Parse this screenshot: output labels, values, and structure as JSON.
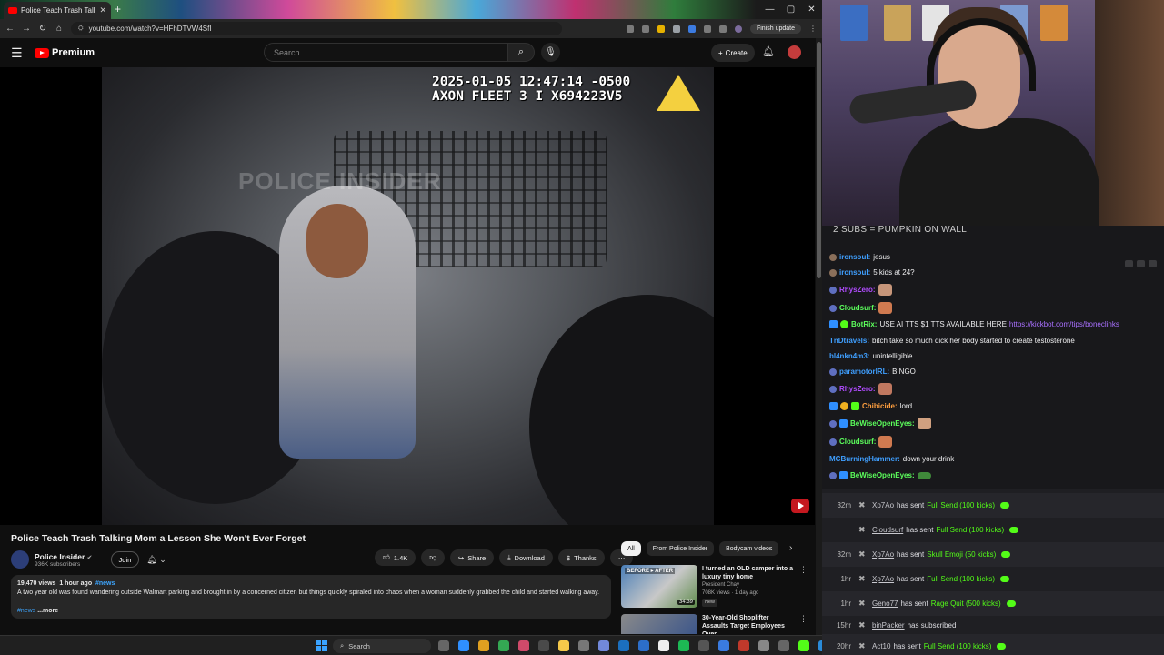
{
  "browser": {
    "tab_title": "Police Teach Trash Talking M",
    "tab_close": "✕",
    "new_tab": "+",
    "url": "youtube.com/watch?v=HFhDTVW4SfI",
    "finish_update": "Finish update",
    "win_minimize": "—",
    "win_maximize": "▢",
    "win_close": "✕"
  },
  "youtube": {
    "logo_text": "Premium",
    "search_placeholder": "Search",
    "create_label": "Create",
    "video_overlay_line1": "2025-01-05 12:47:14 -0500",
    "video_overlay_line2": "AXON FLEET 3 I X694223V5",
    "watermark": "POLICE INSIDER",
    "title": "Police Teach Trash Talking Mom a Lesson She Won't Ever Forget",
    "channel_name": "Police Insider",
    "channel_subs": "936K subscribers",
    "join_label": "Join",
    "likes": "1.4K",
    "share_label": "Share",
    "download_label": "Download",
    "thanks_label": "Thanks",
    "views": "19,470 views",
    "age": "1 hour ago",
    "desc_tag": "#news",
    "description": "A two year old was found wandering outside Walmart parking and brought in by a concerned citizen but things quickly spiraled into chaos when a woman suddenly grabbed the child and started walking away.",
    "desc_tag_bottom": "#news",
    "more_label": "...more",
    "chips": [
      "All",
      "From Police Insider",
      "Bodycam videos"
    ],
    "recommended": [
      {
        "title": "I turned an OLD camper into a luxury tiny home",
        "channel": "President Chay",
        "meta": "708K views · 1 day ago",
        "badge": "New",
        "duration": "34:39",
        "thumb_text": "BEFORE ▸ AFTER"
      },
      {
        "title": "30-Year-Old Shoplifter Assaults Target Employees Over ...",
        "channel": "",
        "meta": "",
        "badge": "",
        "duration": "",
        "thumb_text": ""
      }
    ]
  },
  "chat": {
    "goal": "2 SUBS = PUMPKIN ON WALL",
    "messages": [
      {
        "user": "ironsoul",
        "color": "#3f9fff",
        "text": "jesus"
      },
      {
        "user": "ironsoul",
        "color": "#3f9fff",
        "text": "5 kids at 24?"
      },
      {
        "user": "RhysZero",
        "color": "#b14cff",
        "text": ""
      },
      {
        "user": "Cloudsurf",
        "color": "#5cff5c",
        "text": ""
      },
      {
        "user": "BotRix",
        "color": "#5cff5c",
        "text": "USE AI TTS $1 TTS AVAILABLE HERE",
        "link": "https://kickbot.com/tips/boneclinks"
      },
      {
        "user": "TnDtravels",
        "color": "#3f9fff",
        "text": "bitch take so much dick her body started to create testosterone"
      },
      {
        "user": "bl4nkn4m3",
        "color": "#3f9fff",
        "text": "unintelligible"
      },
      {
        "user": "paramotorIRL",
        "color": "#3f9fff",
        "text": "BINGO"
      },
      {
        "user": "RhysZero",
        "color": "#b14cff",
        "text": ""
      },
      {
        "user": "Chibicide",
        "color": "#ff9f3f",
        "text": "lord"
      },
      {
        "user": "BeWiseOpenEyes",
        "color": "#5cff5c",
        "text": ""
      },
      {
        "user": "Cloudsurf",
        "color": "#5cff5c",
        "text": ""
      },
      {
        "user": "MCBurningHammer",
        "color": "#3f9fff",
        "text": "down your drink"
      },
      {
        "user": "BeWiseOpenEyes",
        "color": "#5cff5c",
        "text": ""
      }
    ]
  },
  "events": [
    {
      "time": "32m",
      "user": "Xp7Ao",
      "action": "has sent",
      "item": "Full Send (100 kicks)"
    },
    {
      "time": "",
      "user": "Cloudsurf",
      "action": "has sent",
      "item": "Full Send (100 kicks)"
    },
    {
      "time": "32m",
      "user": "Xp7Ao",
      "action": "has sent",
      "item": "Skull Emoji (50 kicks)"
    },
    {
      "time": "1hr",
      "user": "Xp7Ao",
      "action": "has sent",
      "item": "Full Send (100 kicks)"
    },
    {
      "time": "1hr",
      "user": "Geno77",
      "action": "has sent",
      "item": "Rage Quit (500 kicks)"
    },
    {
      "time": "15hr",
      "user": "binPacker",
      "action": "has subscribed",
      "item": ""
    },
    {
      "time": "20hr",
      "user": "Act10",
      "action": "has sent",
      "item": "Full Send (100 kicks)"
    }
  ],
  "taskbar": {
    "search_label": "Search"
  },
  "colors": {
    "youtube_red": "#ff0000",
    "kick_green": "#53fc18",
    "link_purple": "#a970ff"
  }
}
